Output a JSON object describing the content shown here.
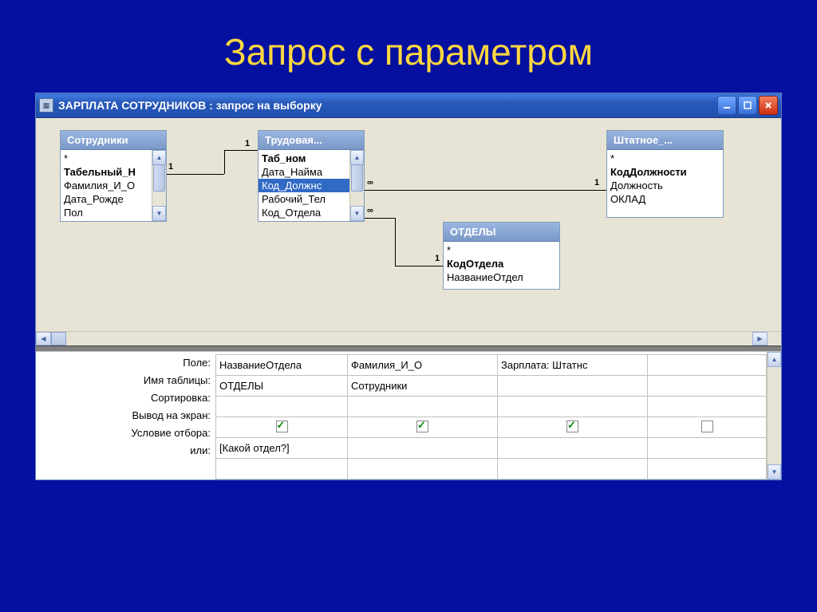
{
  "slide": {
    "title": "Запрос с параметром"
  },
  "window": {
    "title": "ЗАРПЛАТА СОТРУДНИКОВ : запрос на выборку"
  },
  "tables": {
    "t1": {
      "title": "Сотрудники",
      "fields": [
        "*",
        "Табельный_Н",
        "Фамилия_И_О",
        "Дата_Рожде",
        "Пол"
      ],
      "boldIdx": 1
    },
    "t2": {
      "title": "Трудовая...",
      "fields": [
        "Таб_ном",
        "Дата_Найма",
        "Код_Должнс",
        "Рабочий_Тел",
        "Код_Отдела"
      ],
      "boldIdx": 0,
      "selIdx": 2
    },
    "t3": {
      "title": "ОТДЕЛЫ",
      "fields": [
        "*",
        "КодОтдела",
        "НазваниеОтдел"
      ],
      "boldIdx": 1
    },
    "t4": {
      "title": "Штатное_...",
      "fields": [
        "*",
        "КодДолжности",
        "Должность",
        "ОКЛАД"
      ],
      "boldIdx": 1
    }
  },
  "relations": {
    "r1": {
      "left": "1",
      "right": "1"
    },
    "r2": {
      "left": "∞",
      "right": "1"
    },
    "r3": {
      "left": "∞",
      "right": "1"
    }
  },
  "gridLabels": {
    "field": "Поле:",
    "table": "Имя таблицы:",
    "sort": "Сортировка:",
    "show": "Вывод на экран:",
    "criteria": "Условие отбора:",
    "or": "или:"
  },
  "gridCols": [
    {
      "field": "НазваниеОтдела",
      "table": "ОТДЕЛЫ",
      "show": true,
      "criteria": "[Какой отдел?]"
    },
    {
      "field": "Фамилия_И_О",
      "table": "Сотрудники",
      "show": true,
      "criteria": ""
    },
    {
      "field": "Зарплата: Штатнс",
      "table": "",
      "show": true,
      "criteria": ""
    },
    {
      "field": "",
      "table": "",
      "show": false,
      "criteria": ""
    }
  ]
}
